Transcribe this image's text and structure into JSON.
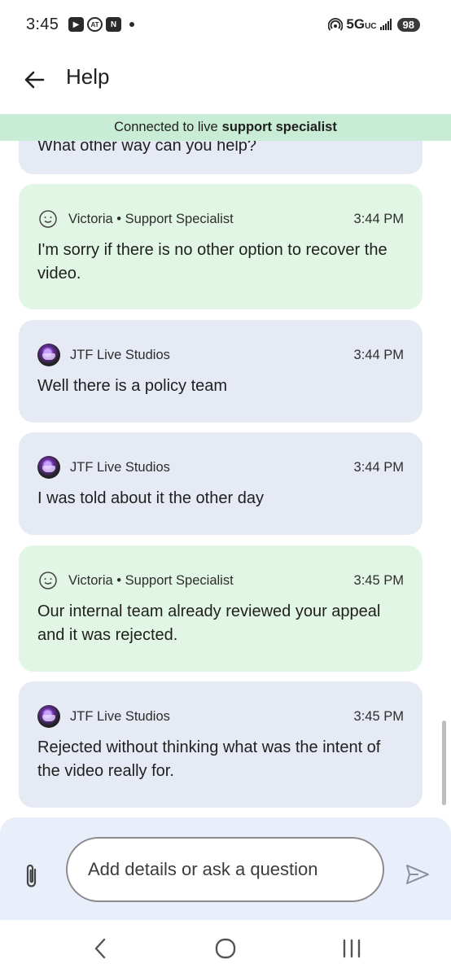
{
  "status_bar": {
    "time": "3:45",
    "network": "5G",
    "network_sub": "UC",
    "battery": "98",
    "icons": [
      "youtube-icon",
      "at-icon",
      "n-icon"
    ]
  },
  "app_bar": {
    "title": "Help"
  },
  "banner": {
    "prefix": "Connected to live",
    "bold": "support specialist"
  },
  "chat": {
    "partial_message": "What other way can you help?",
    "messages": [
      {
        "role": "agent",
        "sender": "Victoria • Support Specialist",
        "time": "3:44 PM",
        "text": "I'm sorry if there is no other option to recover the video."
      },
      {
        "role": "user",
        "sender": "JTF Live Studios",
        "time": "3:44 PM",
        "text": "Well there is a policy team"
      },
      {
        "role": "user",
        "sender": "JTF Live Studios",
        "time": "3:44 PM",
        "text": "I was told about it the other day"
      },
      {
        "role": "agent",
        "sender": "Victoria • Support Specialist",
        "time": "3:45 PM",
        "text": "Our internal team already reviewed your appeal and it was rejected."
      },
      {
        "role": "user",
        "sender": "JTF Live Studios",
        "time": "3:45 PM",
        "text": "Rejected without thinking what was the intent of the video really for."
      }
    ]
  },
  "composer": {
    "placeholder": "Add details or ask a question"
  },
  "colors": {
    "banner": "#c8ecd6",
    "agent_bubble": "#e2f6e6",
    "user_bubble": "#e6eaf4",
    "composer_bg": "#e8effa"
  }
}
